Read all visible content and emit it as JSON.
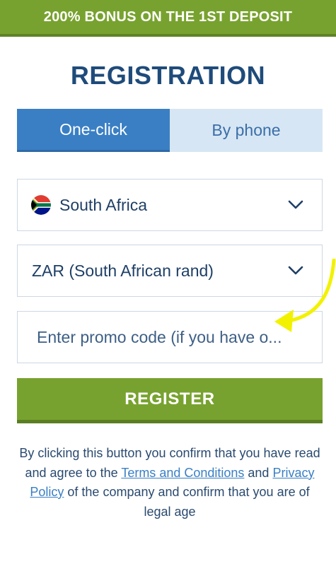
{
  "banner": {
    "text": "200% BONUS ON THE 1ST DEPOSIT"
  },
  "title": "REGISTRATION",
  "tabs": [
    {
      "label": "One-click",
      "active": true
    },
    {
      "label": "By phone",
      "active": false
    }
  ],
  "country_select": {
    "value": "South Africa",
    "flag_icon": "south-africa-flag-icon",
    "chevron_icon": "chevron-down-icon"
  },
  "currency_select": {
    "value": "ZAR (South African rand)",
    "chevron_icon": "chevron-down-icon"
  },
  "promo": {
    "placeholder": "Enter promo code (if you have o..."
  },
  "register_button": {
    "label": "REGISTER"
  },
  "legal": {
    "text_1": "By clicking this button you confirm that you have read and agree to the ",
    "terms_link": "Terms and Conditions",
    "text_2": " and ",
    "privacy_link": "Privacy Policy",
    "text_3": " of the company and confirm that you are of legal age"
  },
  "colors": {
    "banner_green": "#78a22f",
    "title_blue": "#1e4b7a",
    "tab_active_blue": "#3a7fc4",
    "tab_inactive_blue": "#d7e6f4",
    "arrow_yellow": "#f2f200"
  },
  "overlay": {
    "arrow_icon": "yellow-curved-arrow-icon"
  }
}
